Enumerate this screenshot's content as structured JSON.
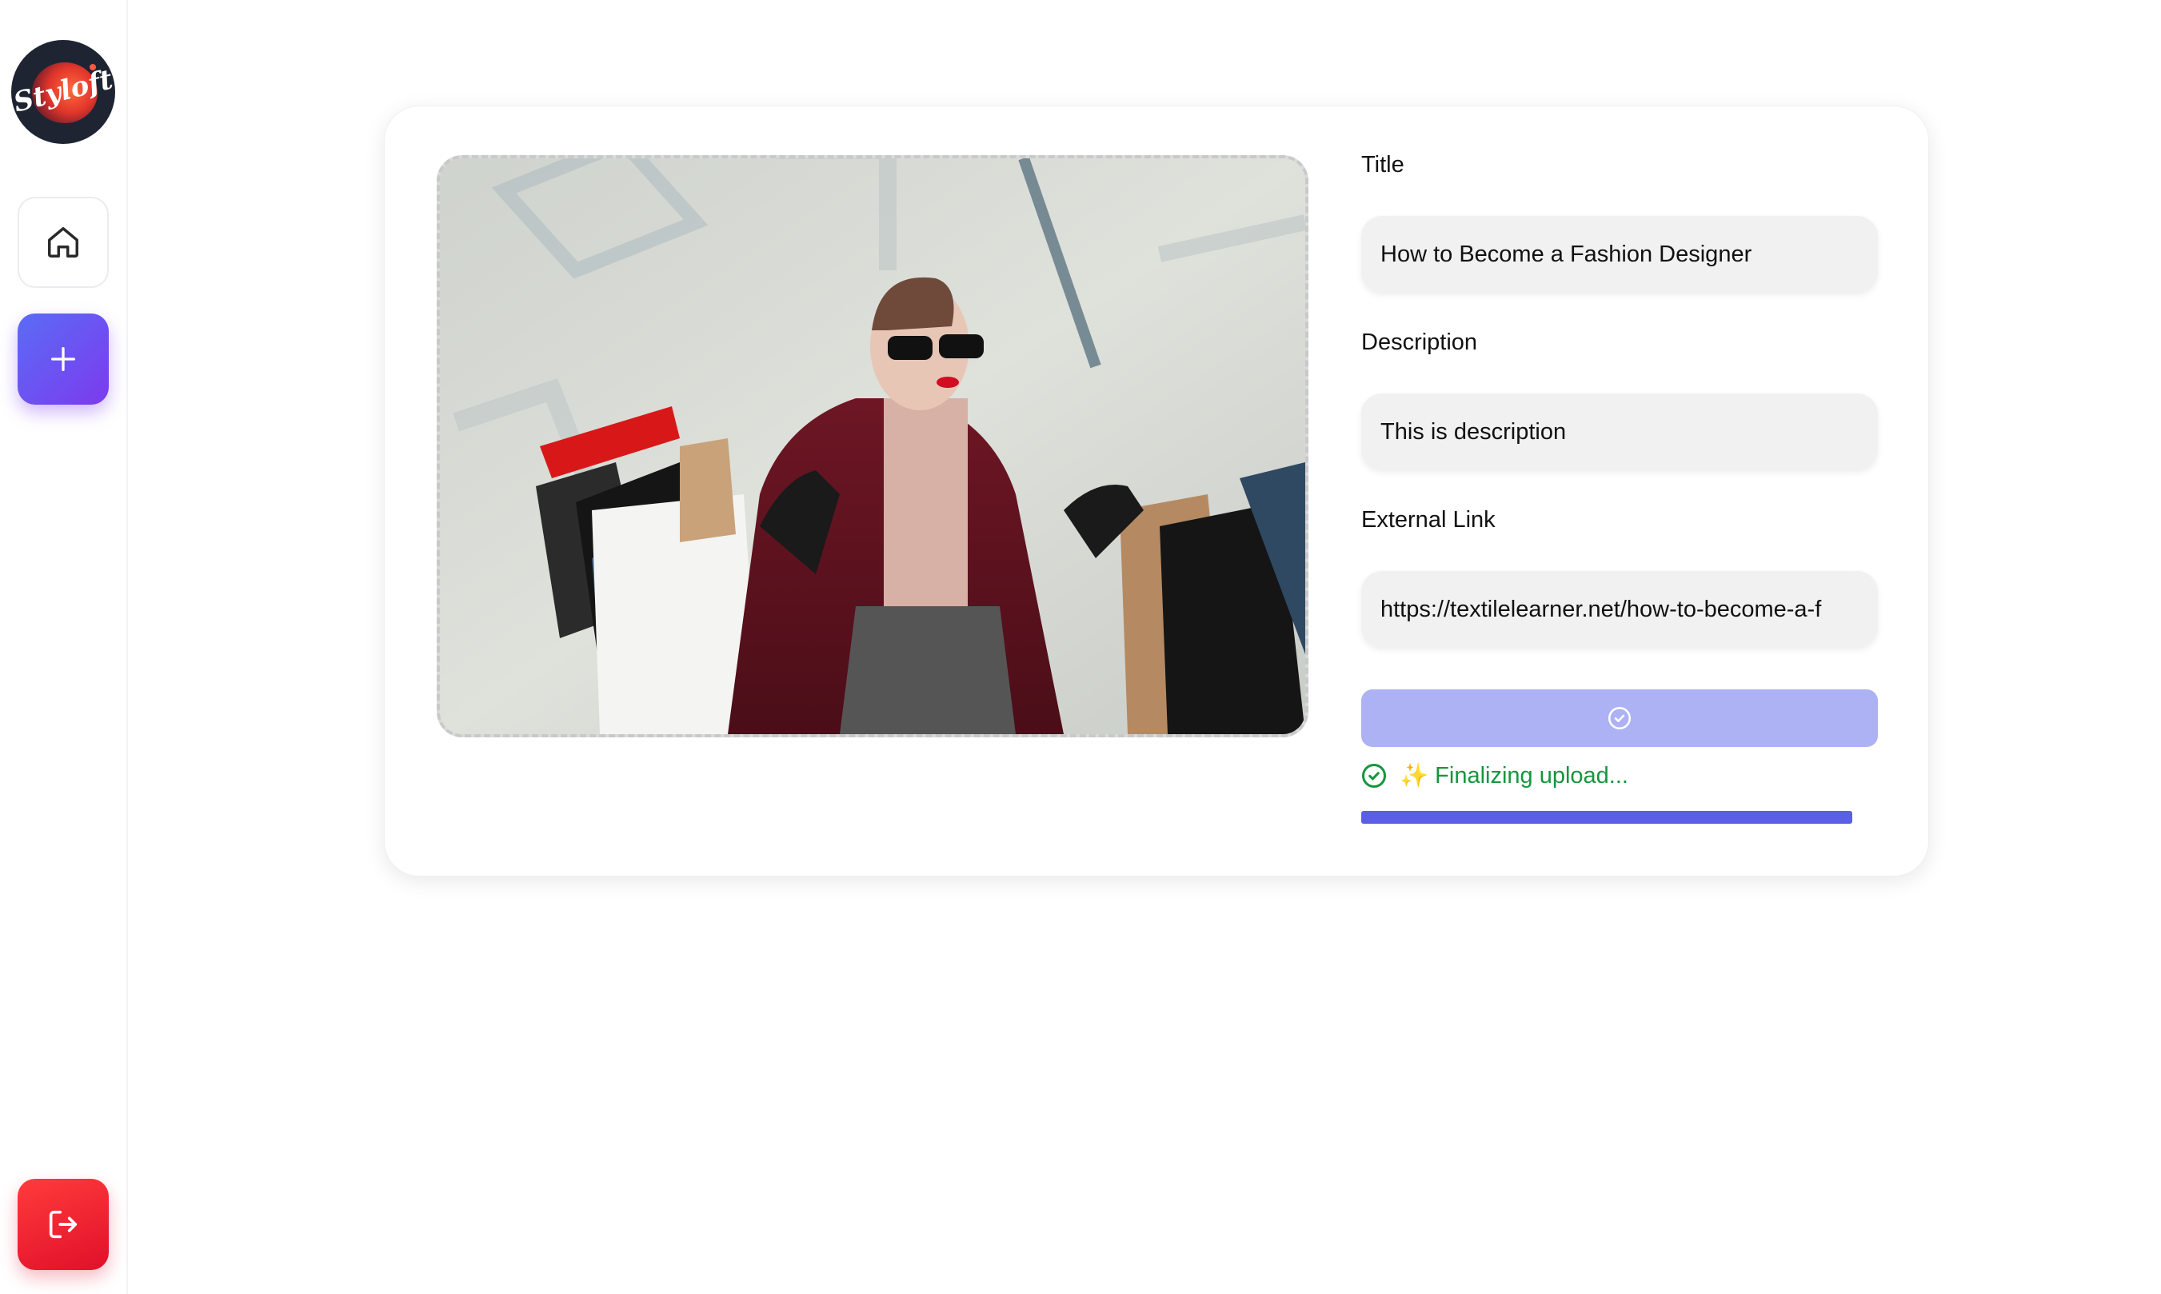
{
  "sidebar": {
    "logo_text": "Styloft",
    "items": [
      {
        "name": "home",
        "icon": "home-icon"
      },
      {
        "name": "add",
        "icon": "plus-icon"
      }
    ],
    "logout_icon": "logout-icon"
  },
  "form": {
    "title_label": "Title",
    "title_value": "How to Become a Fashion Designer",
    "description_label": "Description",
    "description_value": "This is description",
    "link_label": "External Link",
    "link_value": "https://textilelearner.net/how-to-become-a-f",
    "submit_icon": "check-circle-icon"
  },
  "upload": {
    "status_text": "✨ Finalizing upload...",
    "progress": 1.0
  },
  "colors": {
    "accent": "#5a5fe8",
    "submit_disabled": "#adb2f5",
    "success": "#15963e",
    "danger": "#e0102a"
  }
}
